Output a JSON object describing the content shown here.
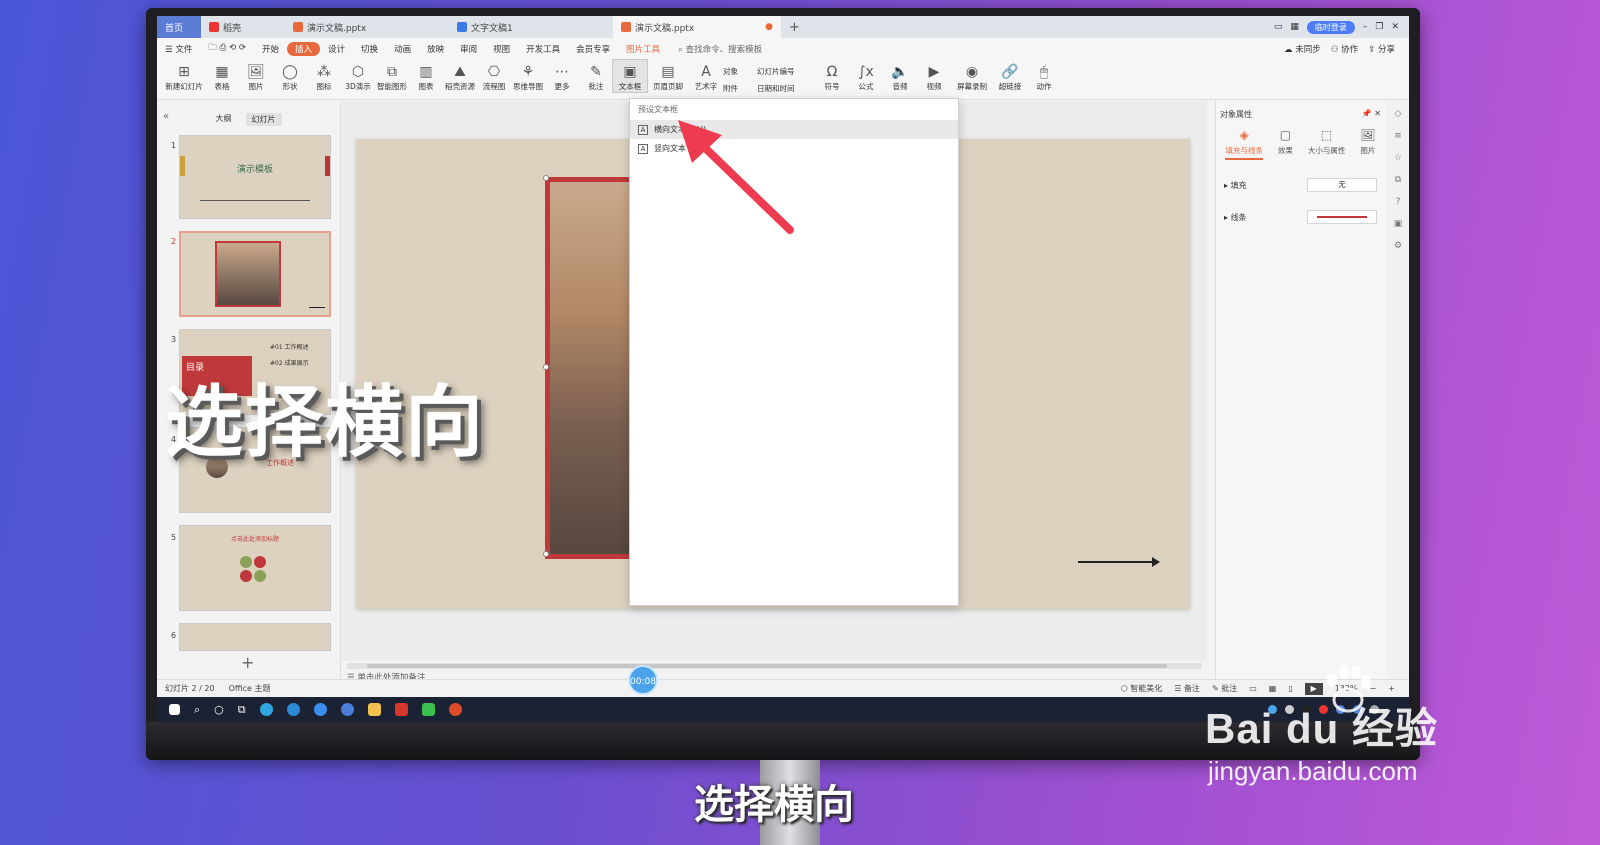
{
  "tabs": {
    "home": "首页",
    "daoke": "稻壳",
    "doc1": "演示文稿.pptx",
    "doc2": "文字文稿1",
    "doc3": "演示文稿.pptx",
    "login": "临时登录"
  },
  "menu": {
    "file": "文件",
    "items": [
      "开始",
      "插入",
      "设计",
      "切换",
      "动画",
      "放映",
      "审阅",
      "视图",
      "开发工具",
      "会员专享",
      "图片工具"
    ],
    "search": "查找命令、搜索模板",
    "sync": "未同步",
    "collab": "协作",
    "share": "分享"
  },
  "ribbon": {
    "new_slide": "新建幻灯片",
    "table": "表格",
    "picture": "图片",
    "shape": "形状",
    "icon": "图标",
    "demo3d": "3D演示",
    "smart": "智能图形",
    "chart": "图表",
    "daoke_res": "稻壳资源",
    "flow": "流程图",
    "mind": "思维导图",
    "more": "更多",
    "comment": "批注",
    "textbox": "文本框",
    "header_footer": "页眉页脚",
    "wordart": "艺术字",
    "object": "对象",
    "attach": "附件",
    "slide_num": "幻灯片编号",
    "datetime": "日期和时间",
    "symbol": "符号",
    "formula": "公式",
    "audio": "音频",
    "video": "视频",
    "screen_rec": "屏幕录制",
    "hyperlink": "超链接",
    "action": "动作"
  },
  "left_panel": {
    "tab_outline": "大纲",
    "tab_slides": "幻灯片",
    "slide1_title": "演示模板",
    "slide3_items": [
      "#01 工作概述",
      "#02 成果展示"
    ],
    "slide3_title": "目录",
    "slide4_title": "工作概述",
    "slide5_title": "点击此处添加标题",
    "slide_numbers": [
      "1",
      "2",
      "3",
      "4",
      "5",
      "6"
    ]
  },
  "dropdown": {
    "header": "预设文本框",
    "horizontal": "横向文本框(H)",
    "vertical": "竖向文本"
  },
  "right_panel": {
    "title": "对象属性",
    "tabs": [
      "填充与线条",
      "效果",
      "大小与属性",
      "图片"
    ],
    "fill_label": "填充",
    "fill_value": "无",
    "line_label": "线条"
  },
  "notes_placeholder": "单击此处添加备注",
  "status": {
    "slide_count": "幻灯片 2 / 20",
    "theme": "Office 主题",
    "beautify": "智能美化",
    "notes": "备注",
    "comments": "批注",
    "zoom": "132%"
  },
  "timer": "00:08",
  "caption_big": "选择横向",
  "caption_bottom": "选择横向",
  "watermark": {
    "main": "Bai du 经验",
    "sub": "jingyan.baidu.com"
  },
  "colors": {
    "accent": "#e9693f",
    "photo_frame": "#c0393a",
    "slide_bg": "#ddd2c0",
    "arrow": "#ee3b4f"
  }
}
